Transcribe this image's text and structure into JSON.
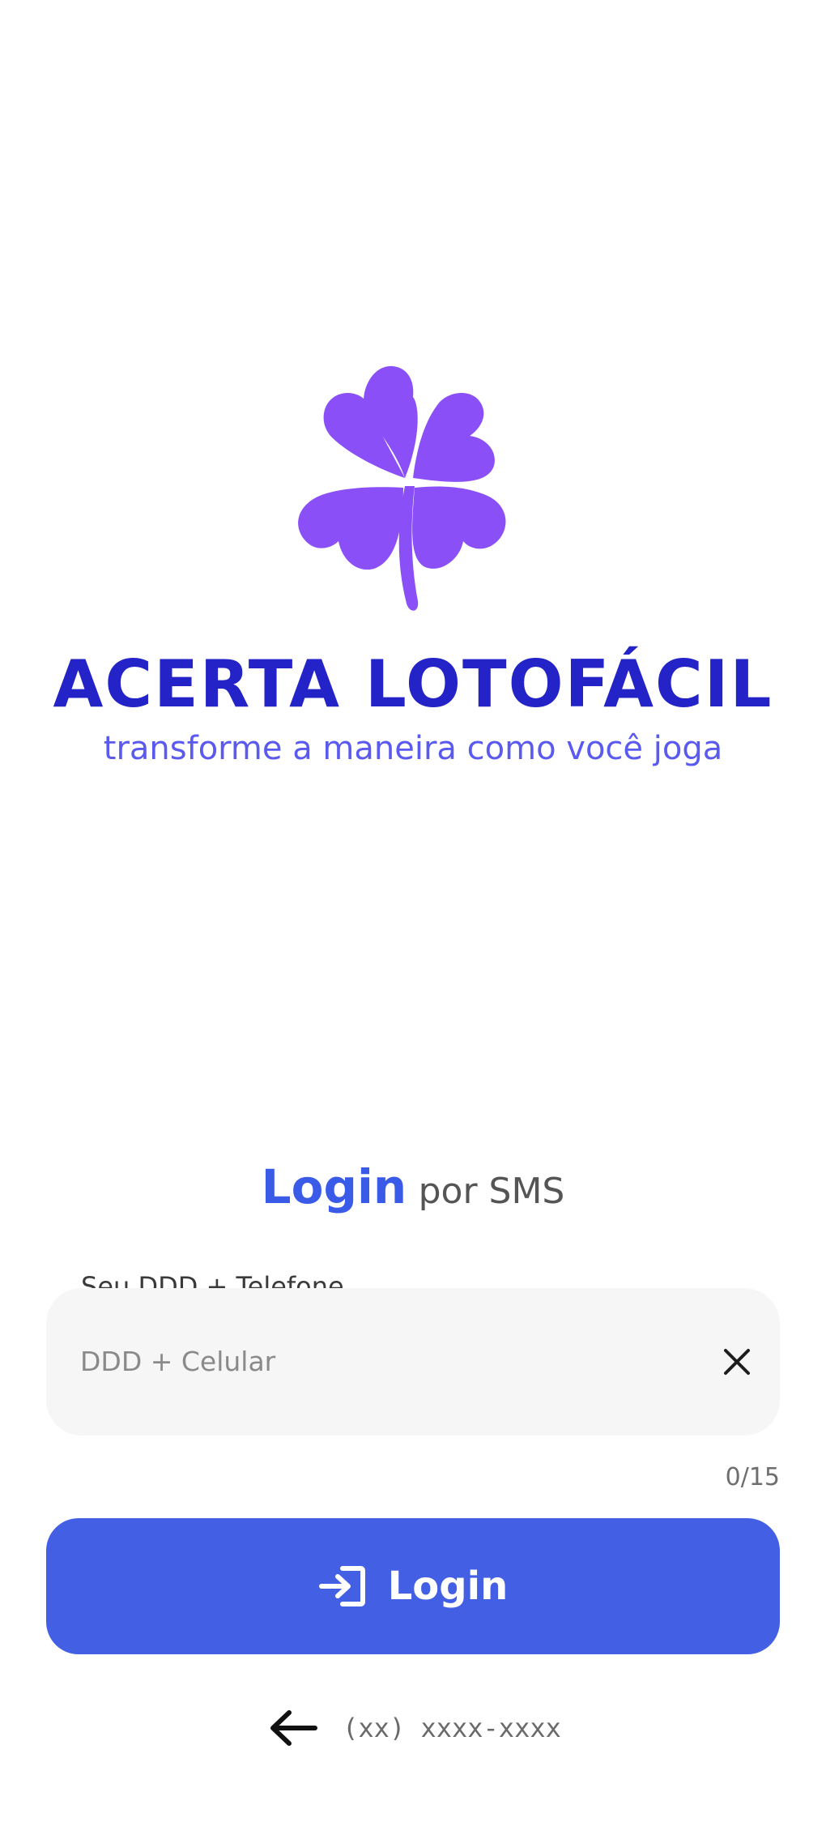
{
  "brand": {
    "name": "ACERTA LOTOFÁCIL",
    "tagline": "transforme a maneira como você joga",
    "logo_icon": "four-leaf-clover-icon",
    "logo_color": "#8a4ff7",
    "title_color": "#2323c8"
  },
  "login": {
    "heading_strong": "Login",
    "heading_rest": "por SMS",
    "field_label": "Seu DDD + Telefone",
    "phone_placeholder": "DDD + Celular",
    "phone_value": "",
    "char_counter": "0/15",
    "clear_icon": "close-icon",
    "button_icon": "login-arrow-icon",
    "button_label": "Login",
    "button_color": "#435fe4"
  },
  "footer": {
    "back_icon": "arrow-left-icon",
    "phone_mask": "(xx) xxxx-xxxx"
  }
}
